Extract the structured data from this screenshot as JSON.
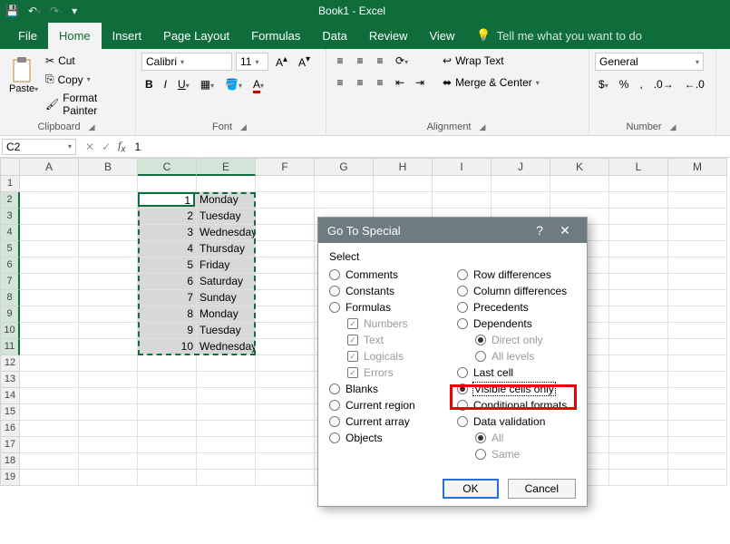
{
  "title": "Book1 - Excel",
  "tabs": {
    "file": "File",
    "home": "Home",
    "insert": "Insert",
    "pagelayout": "Page Layout",
    "formulas": "Formulas",
    "data": "Data",
    "review": "Review",
    "view": "View",
    "tellme": "Tell me what you want to do"
  },
  "ribbon": {
    "clipboard": {
      "paste": "Paste",
      "cut": "Cut",
      "copy": "Copy",
      "formatpainter": "Format Painter",
      "label": "Clipboard"
    },
    "font": {
      "name": "Calibri",
      "size": "11",
      "label": "Font"
    },
    "alignment": {
      "wrap": "Wrap Text",
      "merge": "Merge & Center",
      "label": "Alignment"
    },
    "number": {
      "format": "General",
      "label": "Number"
    }
  },
  "fbar": {
    "name": "C2",
    "value": "1"
  },
  "columns": [
    "A",
    "B",
    "C",
    "E",
    "F",
    "G",
    "H",
    "I",
    "J",
    "K",
    "L",
    "M"
  ],
  "rowdata": [
    {
      "r": 1,
      "c": "",
      "e": ""
    },
    {
      "r": 2,
      "c": "1",
      "e": "Monday"
    },
    {
      "r": 3,
      "c": "2",
      "e": "Tuesday"
    },
    {
      "r": 4,
      "c": "3",
      "e": "Wednesday"
    },
    {
      "r": 5,
      "c": "4",
      "e": "Thursday"
    },
    {
      "r": 6,
      "c": "5",
      "e": "Friday"
    },
    {
      "r": 7,
      "c": "6",
      "e": "Saturday"
    },
    {
      "r": 8,
      "c": "7",
      "e": "Sunday"
    },
    {
      "r": 9,
      "c": "8",
      "e": "Monday"
    },
    {
      "r": 10,
      "c": "9",
      "e": "Tuesday"
    },
    {
      "r": 11,
      "c": "10",
      "e": "Wednesday"
    },
    {
      "r": 12,
      "c": "",
      "e": ""
    },
    {
      "r": 13,
      "c": "",
      "e": ""
    },
    {
      "r": 14,
      "c": "",
      "e": ""
    },
    {
      "r": 15,
      "c": "",
      "e": ""
    },
    {
      "r": 16,
      "c": "",
      "e": ""
    },
    {
      "r": 17,
      "c": "",
      "e": ""
    },
    {
      "r": 18,
      "c": "",
      "e": ""
    },
    {
      "r": 19,
      "c": "",
      "e": ""
    }
  ],
  "dialog": {
    "title": "Go To Special",
    "section": "Select",
    "left": {
      "comments": "Comments",
      "constants": "Constants",
      "formulas": "Formulas",
      "numbers": "Numbers",
      "text": "Text",
      "logicals": "Logicals",
      "errors": "Errors",
      "blanks": "Blanks",
      "currentregion": "Current region",
      "currentarray": "Current array",
      "objects": "Objects"
    },
    "right": {
      "rowdiff": "Row differences",
      "coldiff": "Column differences",
      "precedents": "Precedents",
      "dependents": "Dependents",
      "directonly": "Direct only",
      "alllevels": "All levels",
      "lastcell": "Last cell",
      "visible": "Visible cells only",
      "condfmt": "Conditional formats",
      "datavalid": "Data validation",
      "all": "All",
      "same": "Same"
    },
    "ok": "OK",
    "cancel": "Cancel"
  }
}
